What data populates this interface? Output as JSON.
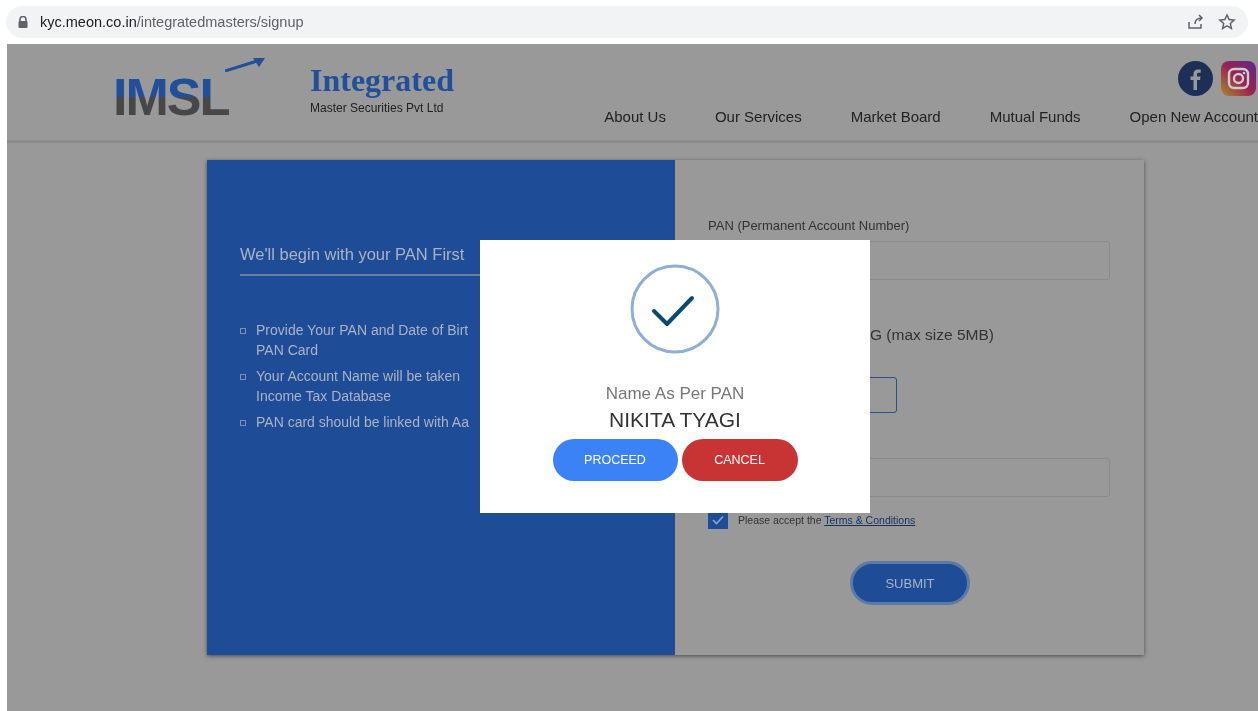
{
  "browser": {
    "url_host": "kyc.meon.co.in",
    "url_path": "/integratedmasters/signup"
  },
  "header": {
    "logo_text": "IMSL",
    "brand_title": "Integrated",
    "brand_subtitle": "Master Securities Pvt Ltd",
    "nav": [
      "About Us",
      "Our Services",
      "Market Board",
      "Mutual Funds",
      "Open New Account"
    ]
  },
  "intro": {
    "heading": "We'll begin with your PAN First",
    "points": [
      {
        "lines": [
          "Provide Your PAN and Date of Birt",
          "PAN Card"
        ]
      },
      {
        "lines": [
          "Your Account Name will be taken",
          "Income Tax Database"
        ]
      },
      {
        "lines": [
          "PAN card should be linked with Aa"
        ]
      }
    ]
  },
  "form": {
    "pan_label": "PAN (Permanent Account Number)",
    "upload_hint": "G (max size 5MB)",
    "terms": {
      "checked": true,
      "text": "Please accept the",
      "link": "Terms & Conditions"
    },
    "submit": "SUBMIT"
  },
  "modal": {
    "caption": "Name As Per PAN",
    "name": "NIKITA TYAGI",
    "buttons": [
      {
        "label": "PROCEED",
        "kind": "primary"
      },
      {
        "label": "CANCEL",
        "kind": "danger"
      }
    ]
  }
}
